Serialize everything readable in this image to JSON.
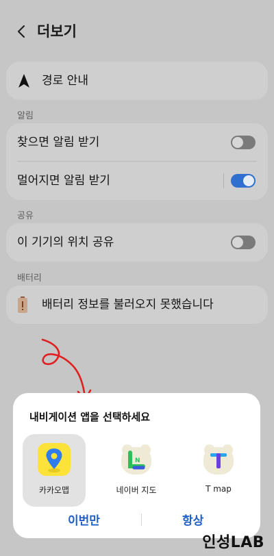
{
  "header": {
    "title": "더보기"
  },
  "route": {
    "label": "경로 안내"
  },
  "alerts": {
    "section_label": "알림",
    "items": [
      {
        "label": "찾으면 알림 받기",
        "enabled": false
      },
      {
        "label": "멀어지면 알림 받기",
        "enabled": true
      }
    ]
  },
  "share": {
    "section_label": "공유",
    "items": [
      {
        "label": "이 기기의 위치 공유",
        "enabled": false
      }
    ]
  },
  "battery": {
    "section_label": "배터리",
    "message": "배터리 정보를 불러오지 못했습니다"
  },
  "sheet": {
    "title": "내비게이션 앱을 선택하세요",
    "apps": [
      {
        "label": "카카오맵",
        "selected": true,
        "icon": "kakaomap-icon"
      },
      {
        "label": "네이버 지도",
        "selected": false,
        "icon": "naver-map-icon"
      },
      {
        "label": "T map",
        "selected": false,
        "icon": "tmap-icon"
      }
    ],
    "once_label": "이번만",
    "always_label": "항상"
  },
  "watermark": "인성LAB",
  "colors": {
    "accent": "#1f5fc4",
    "toggle_on": "#2e6fd0",
    "annotation": "#e02020"
  }
}
